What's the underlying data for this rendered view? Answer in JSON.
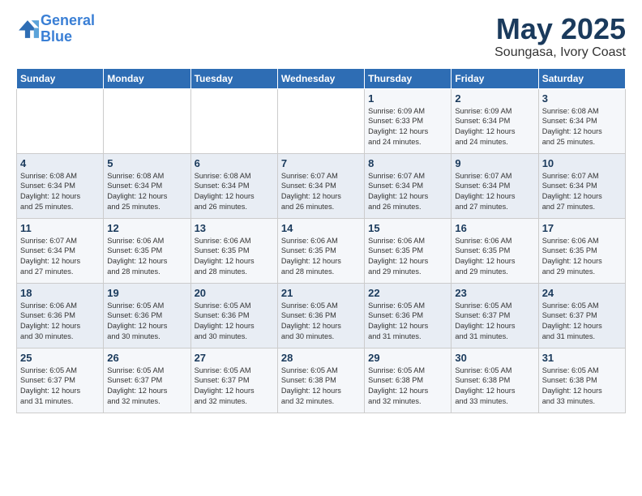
{
  "header": {
    "logo_line1": "General",
    "logo_line2": "Blue",
    "title": "May 2025",
    "subtitle": "Soungasa, Ivory Coast"
  },
  "days_of_week": [
    "Sunday",
    "Monday",
    "Tuesday",
    "Wednesday",
    "Thursday",
    "Friday",
    "Saturday"
  ],
  "weeks": [
    [
      {
        "day": "",
        "info": ""
      },
      {
        "day": "",
        "info": ""
      },
      {
        "day": "",
        "info": ""
      },
      {
        "day": "",
        "info": ""
      },
      {
        "day": "1",
        "info": "Sunrise: 6:09 AM\nSunset: 6:33 PM\nDaylight: 12 hours\nand 24 minutes."
      },
      {
        "day": "2",
        "info": "Sunrise: 6:09 AM\nSunset: 6:34 PM\nDaylight: 12 hours\nand 24 minutes."
      },
      {
        "day": "3",
        "info": "Sunrise: 6:08 AM\nSunset: 6:34 PM\nDaylight: 12 hours\nand 25 minutes."
      }
    ],
    [
      {
        "day": "4",
        "info": "Sunrise: 6:08 AM\nSunset: 6:34 PM\nDaylight: 12 hours\nand 25 minutes."
      },
      {
        "day": "5",
        "info": "Sunrise: 6:08 AM\nSunset: 6:34 PM\nDaylight: 12 hours\nand 25 minutes."
      },
      {
        "day": "6",
        "info": "Sunrise: 6:08 AM\nSunset: 6:34 PM\nDaylight: 12 hours\nand 26 minutes."
      },
      {
        "day": "7",
        "info": "Sunrise: 6:07 AM\nSunset: 6:34 PM\nDaylight: 12 hours\nand 26 minutes."
      },
      {
        "day": "8",
        "info": "Sunrise: 6:07 AM\nSunset: 6:34 PM\nDaylight: 12 hours\nand 26 minutes."
      },
      {
        "day": "9",
        "info": "Sunrise: 6:07 AM\nSunset: 6:34 PM\nDaylight: 12 hours\nand 27 minutes."
      },
      {
        "day": "10",
        "info": "Sunrise: 6:07 AM\nSunset: 6:34 PM\nDaylight: 12 hours\nand 27 minutes."
      }
    ],
    [
      {
        "day": "11",
        "info": "Sunrise: 6:07 AM\nSunset: 6:34 PM\nDaylight: 12 hours\nand 27 minutes."
      },
      {
        "day": "12",
        "info": "Sunrise: 6:06 AM\nSunset: 6:35 PM\nDaylight: 12 hours\nand 28 minutes."
      },
      {
        "day": "13",
        "info": "Sunrise: 6:06 AM\nSunset: 6:35 PM\nDaylight: 12 hours\nand 28 minutes."
      },
      {
        "day": "14",
        "info": "Sunrise: 6:06 AM\nSunset: 6:35 PM\nDaylight: 12 hours\nand 28 minutes."
      },
      {
        "day": "15",
        "info": "Sunrise: 6:06 AM\nSunset: 6:35 PM\nDaylight: 12 hours\nand 29 minutes."
      },
      {
        "day": "16",
        "info": "Sunrise: 6:06 AM\nSunset: 6:35 PM\nDaylight: 12 hours\nand 29 minutes."
      },
      {
        "day": "17",
        "info": "Sunrise: 6:06 AM\nSunset: 6:35 PM\nDaylight: 12 hours\nand 29 minutes."
      }
    ],
    [
      {
        "day": "18",
        "info": "Sunrise: 6:06 AM\nSunset: 6:36 PM\nDaylight: 12 hours\nand 30 minutes."
      },
      {
        "day": "19",
        "info": "Sunrise: 6:05 AM\nSunset: 6:36 PM\nDaylight: 12 hours\nand 30 minutes."
      },
      {
        "day": "20",
        "info": "Sunrise: 6:05 AM\nSunset: 6:36 PM\nDaylight: 12 hours\nand 30 minutes."
      },
      {
        "day": "21",
        "info": "Sunrise: 6:05 AM\nSunset: 6:36 PM\nDaylight: 12 hours\nand 30 minutes."
      },
      {
        "day": "22",
        "info": "Sunrise: 6:05 AM\nSunset: 6:36 PM\nDaylight: 12 hours\nand 31 minutes."
      },
      {
        "day": "23",
        "info": "Sunrise: 6:05 AM\nSunset: 6:37 PM\nDaylight: 12 hours\nand 31 minutes."
      },
      {
        "day": "24",
        "info": "Sunrise: 6:05 AM\nSunset: 6:37 PM\nDaylight: 12 hours\nand 31 minutes."
      }
    ],
    [
      {
        "day": "25",
        "info": "Sunrise: 6:05 AM\nSunset: 6:37 PM\nDaylight: 12 hours\nand 31 minutes."
      },
      {
        "day": "26",
        "info": "Sunrise: 6:05 AM\nSunset: 6:37 PM\nDaylight: 12 hours\nand 32 minutes."
      },
      {
        "day": "27",
        "info": "Sunrise: 6:05 AM\nSunset: 6:37 PM\nDaylight: 12 hours\nand 32 minutes."
      },
      {
        "day": "28",
        "info": "Sunrise: 6:05 AM\nSunset: 6:38 PM\nDaylight: 12 hours\nand 32 minutes."
      },
      {
        "day": "29",
        "info": "Sunrise: 6:05 AM\nSunset: 6:38 PM\nDaylight: 12 hours\nand 32 minutes."
      },
      {
        "day": "30",
        "info": "Sunrise: 6:05 AM\nSunset: 6:38 PM\nDaylight: 12 hours\nand 33 minutes."
      },
      {
        "day": "31",
        "info": "Sunrise: 6:05 AM\nSunset: 6:38 PM\nDaylight: 12 hours\nand 33 minutes."
      }
    ]
  ]
}
